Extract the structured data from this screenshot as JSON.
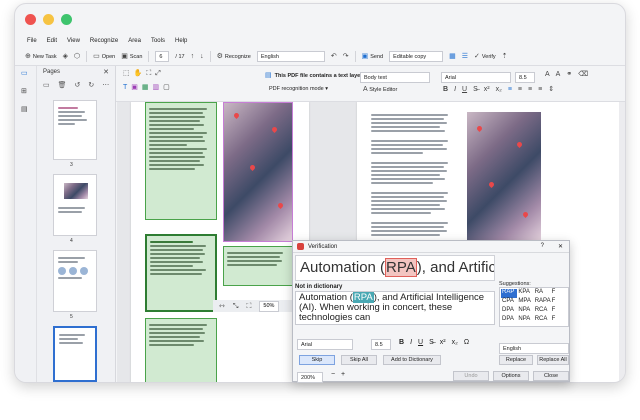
{
  "window": {
    "traffic_colors": {
      "close": "#ef5350",
      "minimize": "#f6c342",
      "maximize": "#3ec46d"
    }
  },
  "menu": [
    "File",
    "Edit",
    "View",
    "Recognize",
    "Area",
    "Tools",
    "Help"
  ],
  "toolbar": {
    "new_task": "New Task",
    "open": "Open",
    "scan": "Scan",
    "page_current": "6",
    "page_total": "/ 17",
    "recognize": "Recognize",
    "language": "English",
    "send": "Send",
    "mode": "Editable copy",
    "verify": "Verify"
  },
  "text_layer": {
    "notice": "This PDF file contains a text layer",
    "recognition_mode": "PDF recognition mode",
    "style": "Body text",
    "style_editor": "Style Editor",
    "font": "Arial",
    "size": "8.5"
  },
  "sidebar": {
    "title": "Pages",
    "thumbs": [
      {
        "label": "3"
      },
      {
        "label": "4"
      },
      {
        "label": "5"
      }
    ]
  },
  "dialog": {
    "title": "Verification",
    "preview_before": "Automation (",
    "preview_word": "RPA",
    "preview_after": "), and Artificial In",
    "not_in_dictionary": "Not in dictionary",
    "edit_before": "Automation (",
    "edit_word": "RPA",
    "edit_after": "), and Artificial Intelligence (AI). When working in concert, these technologies can",
    "suggestions_label": "Suggestions:",
    "suggestions": [
      "RAP",
      "KPA",
      "RA",
      "F",
      "CPA",
      "MPA",
      "RAPA",
      "F",
      "DPA",
      "NPA",
      "RCA",
      "F",
      "DPA",
      "NPA",
      "RCA",
      "F"
    ],
    "font": "Arial",
    "size": "8.5",
    "language": "English",
    "buttons": {
      "skip": "Skip",
      "skip_all": "Skip All",
      "add_to_dictionary": "Add to Dictionary",
      "replace": "Replace",
      "replace_all": "Replace All",
      "options": "Options",
      "close": "Close",
      "undo": "Undo"
    },
    "zoom": "200%"
  },
  "doc": {
    "zoom": "50%"
  }
}
